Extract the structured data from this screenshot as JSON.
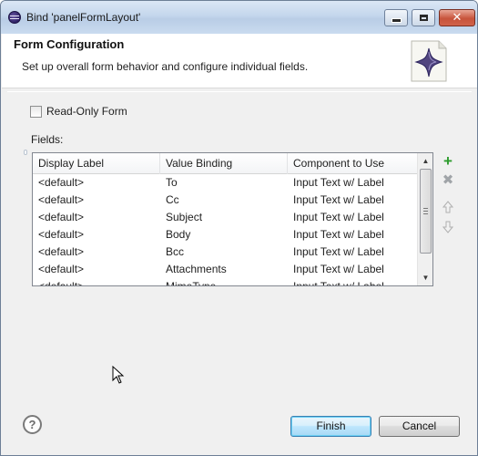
{
  "window": {
    "title": "Bind 'panelFormLayout'"
  },
  "banner": {
    "title": "Form Configuration",
    "description": "Set up overall form behavior and configure individual fields."
  },
  "form": {
    "readonly_label": "Read-Only Form",
    "readonly_checked": false,
    "fields_label": "Fields:"
  },
  "table": {
    "columns": [
      "Display Label",
      "Value Binding",
      "Component to Use"
    ],
    "rows": [
      {
        "label": "<default>",
        "binding": "To",
        "component": "Input Text w/ Label"
      },
      {
        "label": "<default>",
        "binding": "Cc",
        "component": "Input Text w/ Label"
      },
      {
        "label": "<default>",
        "binding": "Subject",
        "component": "Input Text w/ Label"
      },
      {
        "label": "<default>",
        "binding": "Body",
        "component": "Input Text w/ Label"
      },
      {
        "label": "<default>",
        "binding": "Bcc",
        "component": "Input Text w/ Label"
      },
      {
        "label": "<default>",
        "binding": "Attachments",
        "component": "Input Text w/ Label"
      },
      {
        "label": "<default>",
        "binding": "MimeType",
        "component": "Input Text w/ Label"
      }
    ]
  },
  "side_buttons": {
    "add_icon": "plus-icon",
    "delete_icon": "delete-icon",
    "move_up_icon": "arrow-up-icon",
    "move_down_icon": "arrow-down-icon"
  },
  "footer": {
    "help_glyph": "?",
    "finish_label": "Finish",
    "cancel_label": "Cancel"
  },
  "colors": {
    "add_green": "#2d9c2d",
    "default_button_border": "#3c7fb1",
    "titlebar": "#c4d6ec",
    "close_red": "#c7533b"
  }
}
